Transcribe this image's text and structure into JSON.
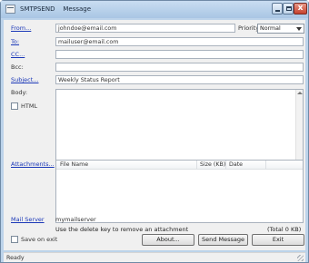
{
  "window": {
    "title": "SMTPSEND    Message",
    "close_glyph": "x"
  },
  "fields": {
    "from": {
      "label": "From...",
      "value": "johndoe@email.com"
    },
    "priority": {
      "label": "Priority",
      "selected": "Normal"
    },
    "to": {
      "label": "To:",
      "value": "mailuser@email.com"
    },
    "cc": {
      "label": "CC...",
      "value": ""
    },
    "bcc": {
      "label": "Bcc:",
      "value": ""
    },
    "subject": {
      "label": "Subject...",
      "value": "Weekly Status Report"
    },
    "body": {
      "label": "Body:",
      "value": ""
    },
    "html": {
      "label": "HTML",
      "checked": false
    }
  },
  "attachments": {
    "label": "Attachments...",
    "columns": [
      "File Name",
      "Size (KB)",
      "Date"
    ],
    "rows": [],
    "hint": "Use the delete key to remove an attachment",
    "total": "(Total    0 KB)"
  },
  "mail_server": {
    "label": "Mail Server",
    "value": "mymailserver"
  },
  "save_on_exit": {
    "label": "Save on exit",
    "checked": false
  },
  "buttons": {
    "about": "About...",
    "send": "Send Message",
    "exit": "Exit"
  },
  "status": {
    "text": "Ready"
  },
  "icons": [
    "app-icon",
    "minimize-icon",
    "maximize-icon",
    "close-icon",
    "chevron-down-icon",
    "scroll-up-icon",
    "scroll-down-icon",
    "resize-grip-icon"
  ]
}
